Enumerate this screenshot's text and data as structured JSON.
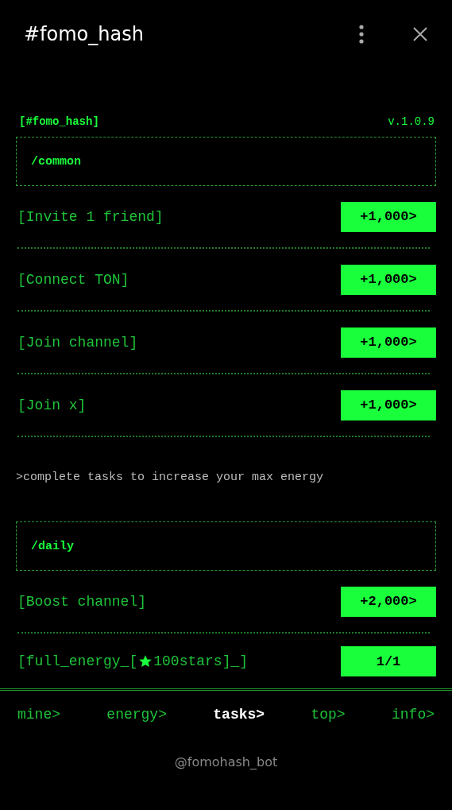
{
  "window": {
    "title": "#fomo_hash"
  },
  "app": {
    "brand": "[#fomo_hash]",
    "version": "v.1.0.9"
  },
  "sections": [
    {
      "title": "/common",
      "tasks": [
        {
          "kind": "plain",
          "label": "[Invite 1 friend]",
          "action": "+1,000>"
        },
        {
          "kind": "plain",
          "label": "[Connect TON]",
          "action": "+1,000>"
        },
        {
          "kind": "plain",
          "label": "[Join channel]",
          "action": "+1,000>"
        },
        {
          "kind": "plain",
          "label": "[Join x]",
          "action": "+1,000>"
        }
      ],
      "note": ">complete tasks to increase your max energy"
    },
    {
      "title": "/daily",
      "tasks": [
        {
          "kind": "plain",
          "label": "[Boost channel]",
          "action": "+2,000>"
        },
        {
          "kind": "starred",
          "label": "[full_energy_[",
          "label_after": "100stars]_]",
          "action": "1/1"
        }
      ]
    }
  ],
  "nav": [
    {
      "label": "mine>",
      "selected": false
    },
    {
      "label": "energy>",
      "selected": false
    },
    {
      "label": "tasks>",
      "selected": true
    },
    {
      "label": "top>",
      "selected": false
    },
    {
      "label": "info>",
      "selected": false
    }
  ],
  "footer": "@fomohash_bot"
}
